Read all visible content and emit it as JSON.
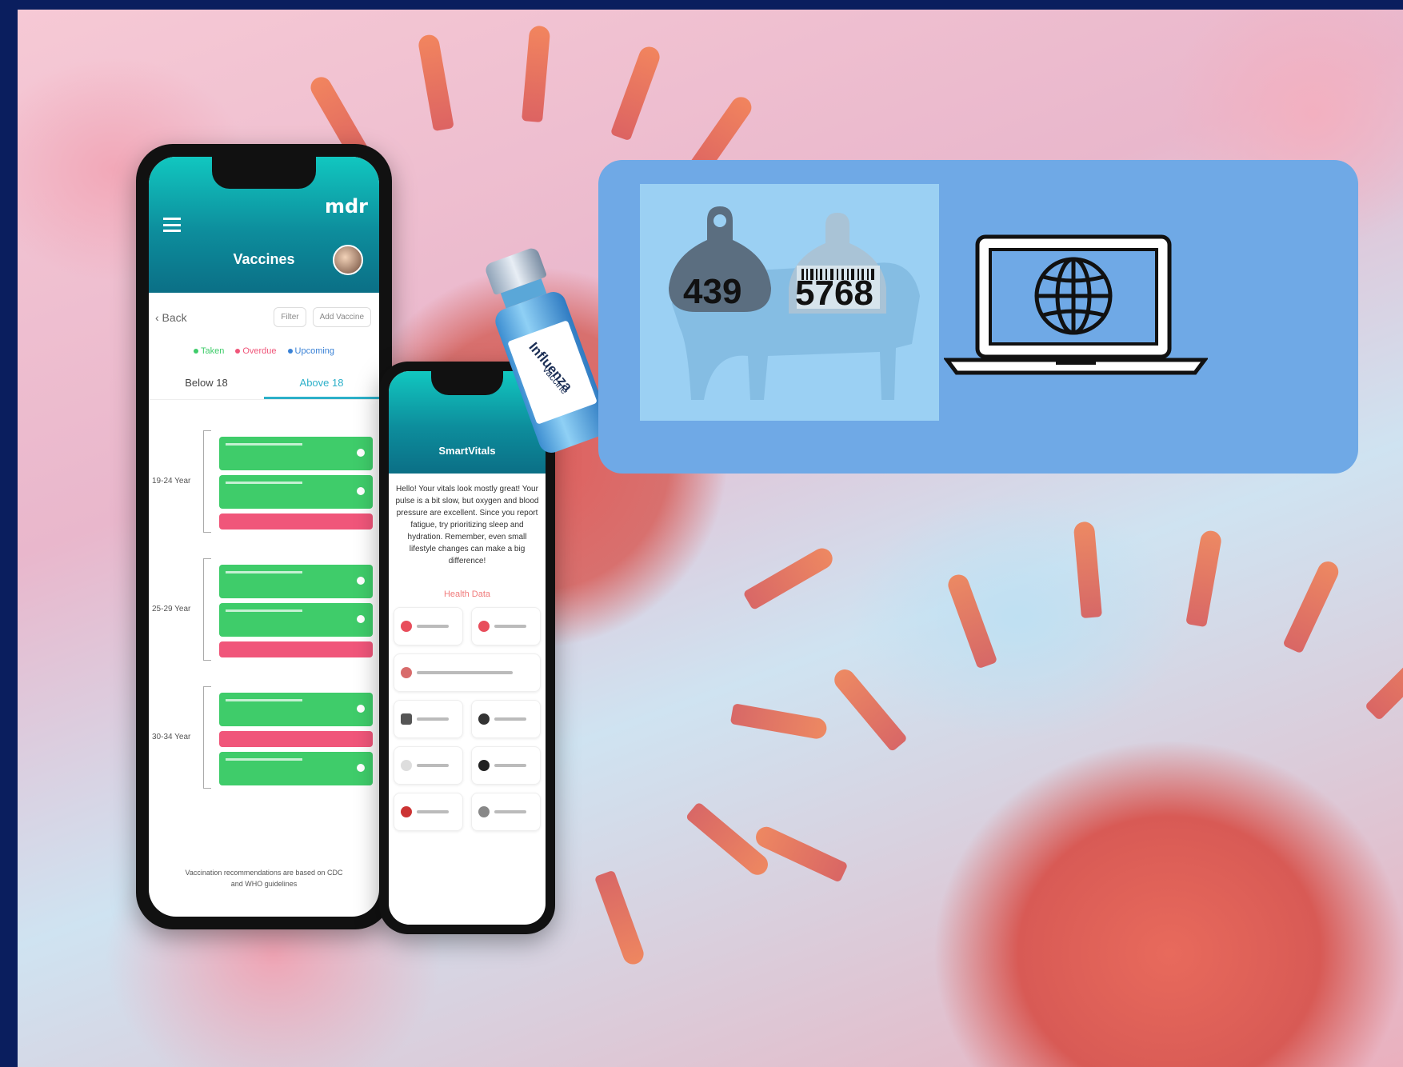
{
  "phone1": {
    "brand": "mdr",
    "title": "Vaccines",
    "back_label": "‹ Back",
    "filter_label": "Filter",
    "add_label": "Add Vaccine",
    "legend": [
      {
        "label": "Taken",
        "color": "#3fcc6a"
      },
      {
        "label": "Overdue",
        "color": "#f0567a"
      },
      {
        "label": "Upcoming",
        "color": "#3a82d6"
      }
    ],
    "tabs": [
      "Below 18",
      "Above 18"
    ],
    "groups": [
      "19-24 Year",
      "25-29 Year",
      "30-34 Year"
    ],
    "footnote": "Vaccination recommendations are based on CDC and WHO guidelines"
  },
  "phone2": {
    "title": "SmartVitals",
    "message": "Hello! Your vitals look mostly great! Your pulse is a bit slow, but oxygen and blood pressure are excellent. Since you report fatigue, try prioritizing sleep and hydration. Remember, even small lifestyle changes can make a big difference!",
    "section": "Health Data"
  },
  "vial": {
    "line1": "Influenza",
    "line2": "Vaccine"
  },
  "panel": {
    "tag1": "439",
    "tag2": "5768"
  },
  "colors": {
    "frame": "#0a1e5e",
    "panel": "#6fa9e6",
    "teal": "#11c7c0",
    "green": "#3fcc6a",
    "pink": "#f0567a"
  },
  "icons": [
    "menu-icon",
    "globe-icon",
    "laptop-icon",
    "cattle-ear-tag-icon",
    "barcode-icon"
  ]
}
